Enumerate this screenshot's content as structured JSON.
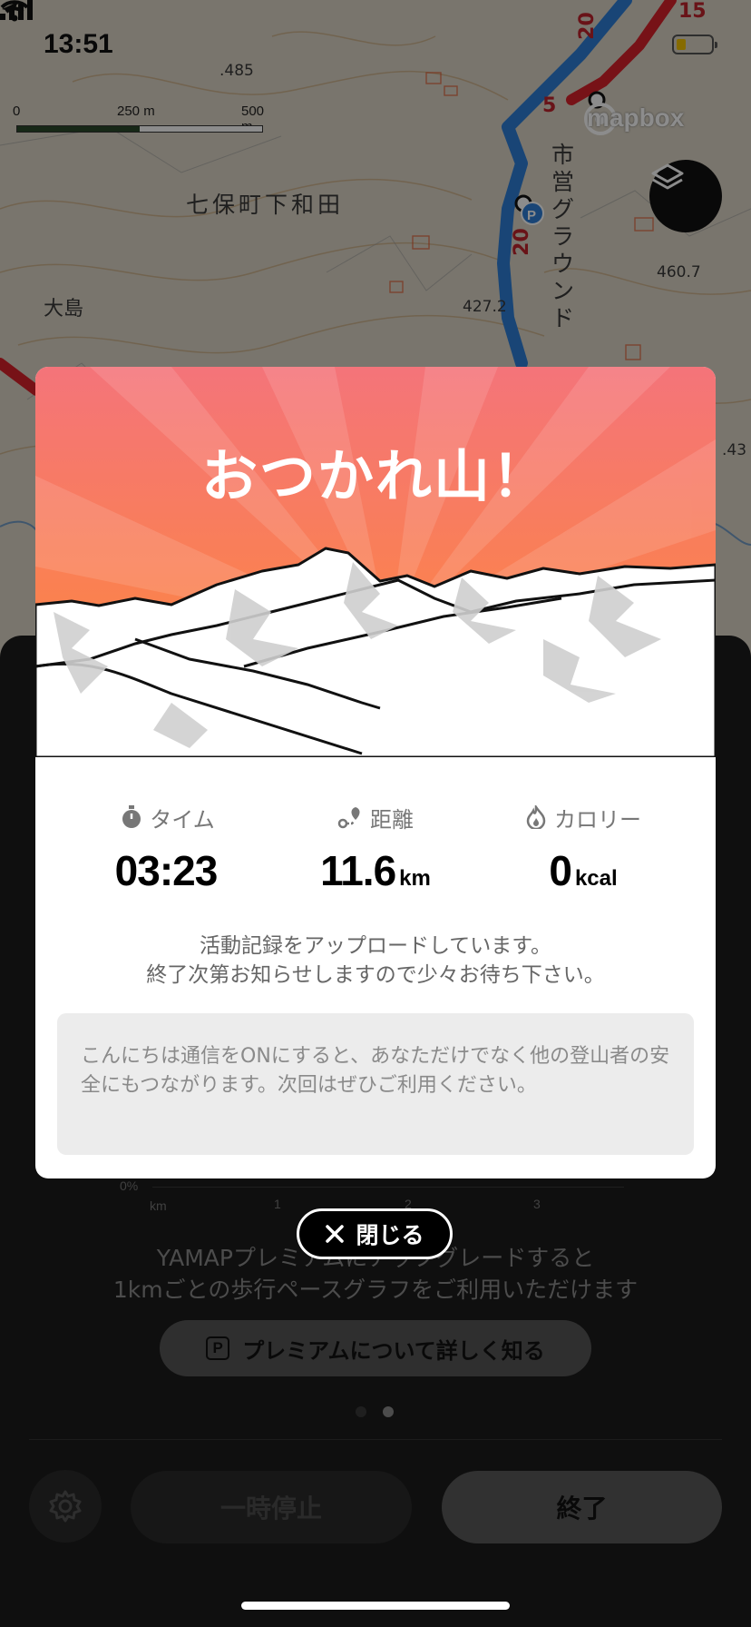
{
  "status_bar": {
    "time": "13:51"
  },
  "map": {
    "scale_labels": [
      "0",
      "250 m",
      "500 m"
    ],
    "attribution": "mapbox",
    "place_names": {
      "area": "七保町下和田",
      "ground": "市営グラウンド",
      "village": "大島"
    },
    "elevations": [
      ".485",
      "460.7",
      "427.2",
      ".43"
    ],
    "route_numbers": [
      "20",
      "15",
      "5",
      "20"
    ]
  },
  "modal": {
    "title": "おつかれ山！",
    "stats": [
      {
        "label": "タイム",
        "value": "03:23",
        "unit": ""
      },
      {
        "label": "距離",
        "value": "11.6",
        "unit": "km"
      },
      {
        "label": "カロリー",
        "value": "0",
        "unit": "kcal"
      }
    ],
    "upload_message_line1": "活動記録をアップロードしています。",
    "upload_message_line2": "終了次第お知らせしますので少々お待ち下さい。",
    "info_text": "こんにちは通信をONにすると、あなただけでなく他の登山者の安全にもつながります。次回はぜひご利用ください。"
  },
  "close_button": {
    "label": "閉じる"
  },
  "sheet": {
    "chart_axis": {
      "y_label": "0%",
      "x_unit": "km",
      "x_ticks": [
        "1",
        "2",
        "3"
      ]
    },
    "premium_line1": "YAMAPプレミアムにアップグレードすると",
    "premium_line2": "1kmごとの歩行ペースグラフをご利用いただけます",
    "premium_button": "プレミアムについて詳しく知る",
    "premium_icon_letter": "P",
    "pause_button": "一時停止",
    "end_button": "終了"
  },
  "colors": {
    "hero_top": "#f4747a",
    "hero_bottom": "#ff8a33",
    "route_blue": "#2f7fd8",
    "route_red": "#d9222b",
    "battery": "#f5c400"
  }
}
